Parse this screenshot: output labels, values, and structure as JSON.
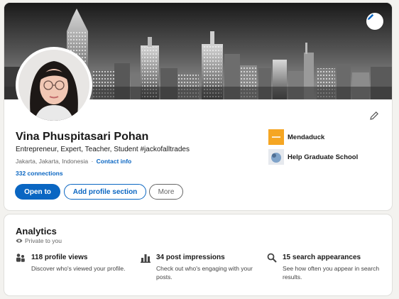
{
  "profile": {
    "name": "Vina Phuspitasari Pohan",
    "headline": "Entrepreneur, Expert, Teacher, Student #jackofalltrades",
    "location": "Jakarta, Jakarta, Indonesia",
    "separator": "·",
    "contact_info": "Contact info",
    "connections": "332 connections",
    "buttons": {
      "open_to": "Open to",
      "add_section": "Add profile section",
      "more": "More"
    },
    "organizations": [
      {
        "name": "Mendaduck",
        "logo_color": "#f5a623"
      },
      {
        "name": "Help Graduate School",
        "logo_color": "#7fa3c9"
      }
    ]
  },
  "analytics": {
    "title": "Analytics",
    "privacy": "Private to you",
    "items": [
      {
        "icon": "people-icon",
        "title": "118 profile views",
        "description": "Discover who's viewed your profile."
      },
      {
        "icon": "bar-chart-icon",
        "title": "34 post impressions",
        "description": "Check out who's engaging with your posts."
      },
      {
        "icon": "search-icon",
        "title": "15 search appearances",
        "description": "See how often you appear in search results."
      }
    ]
  },
  "colors": {
    "accent": "#0a66c2",
    "background": "#f3f2ef"
  }
}
